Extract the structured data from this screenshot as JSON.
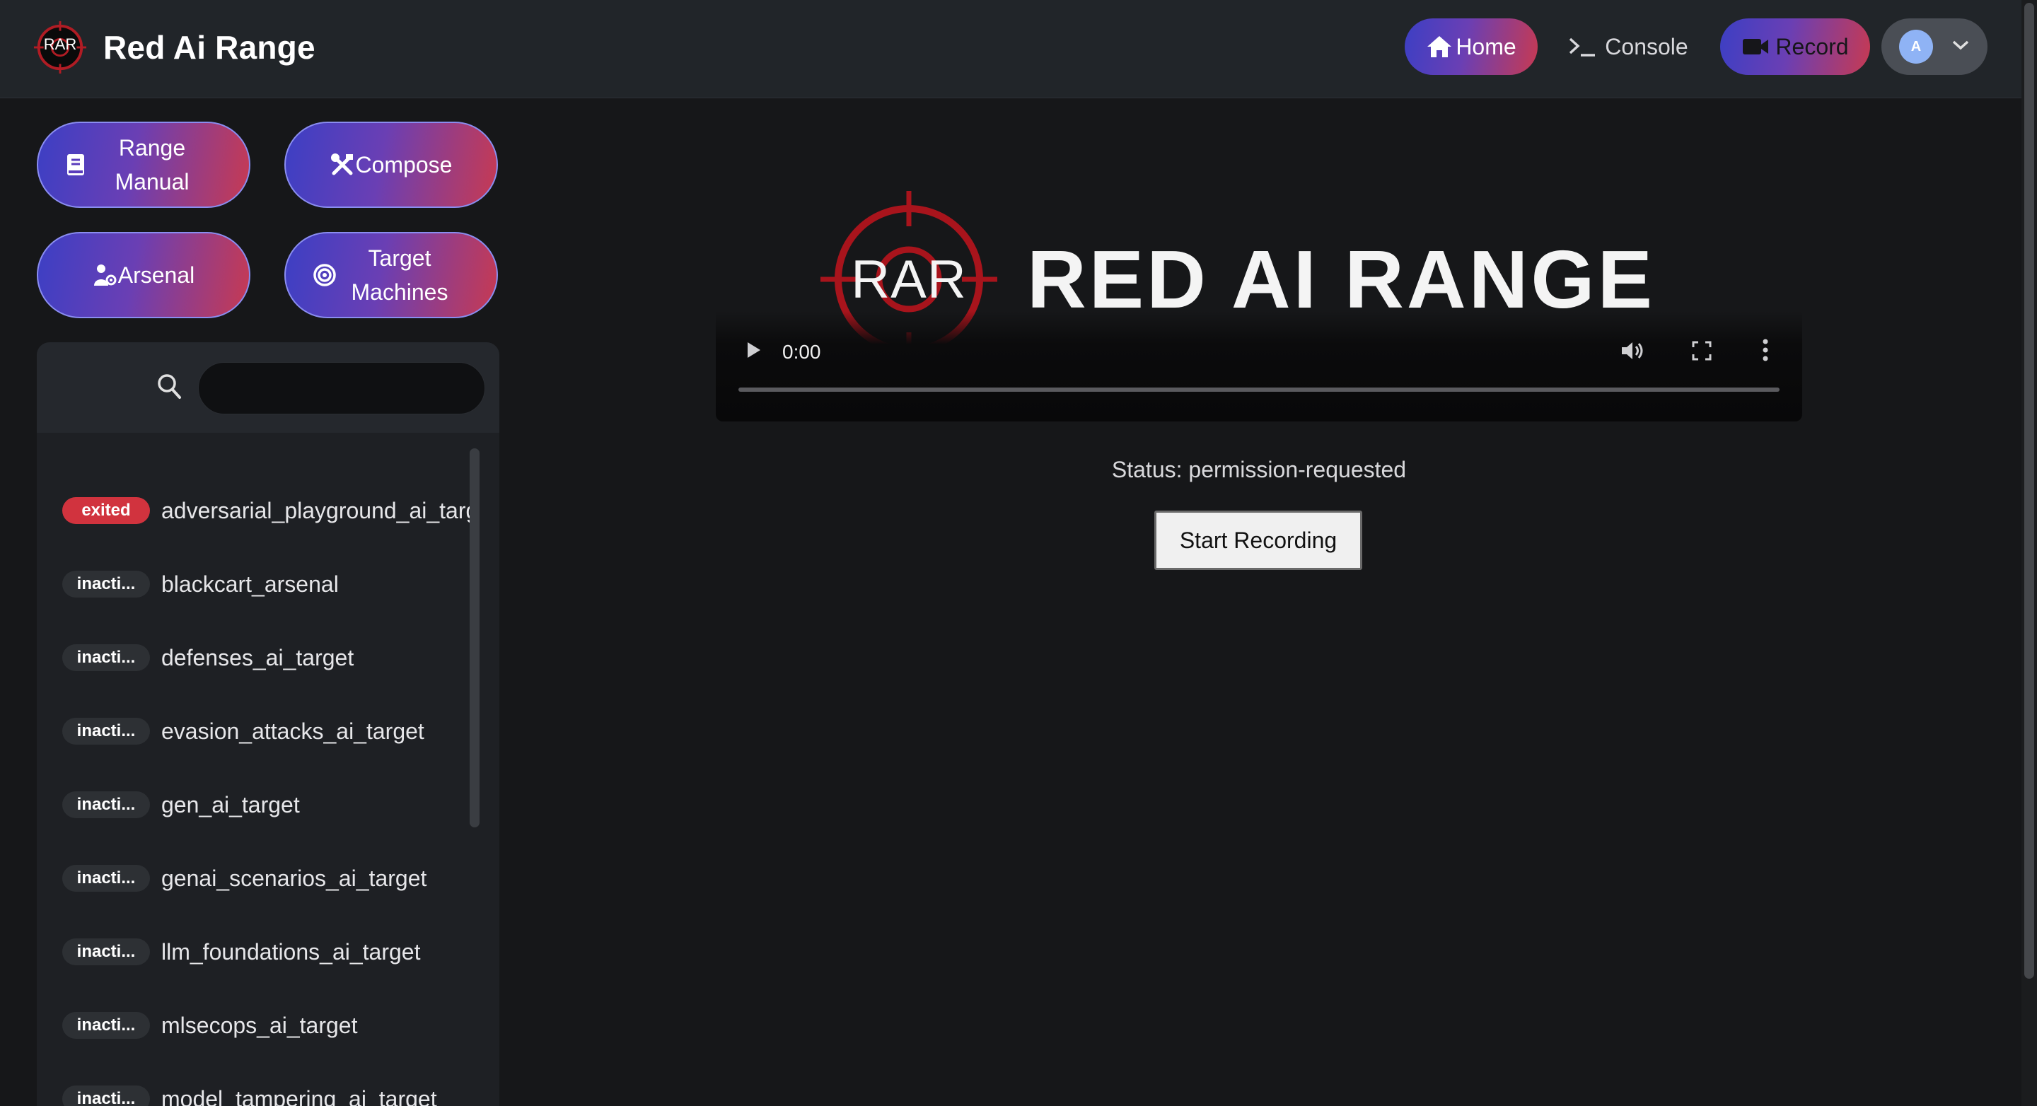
{
  "header": {
    "brand_logo_text": "RAR",
    "title": "Red Ai Range",
    "nav": {
      "home": "Home",
      "console": "Console",
      "record": "Record"
    },
    "user_initial": "A"
  },
  "sidebar": {
    "buttons": {
      "manual": "Range Manual",
      "compose": "Compose",
      "arsenal": "Arsenal",
      "targets": "Target Machines"
    },
    "search": {
      "placeholder": "",
      "value": ""
    },
    "items": [
      {
        "badge": "exited",
        "name": "adversarial_playground_ai_target"
      },
      {
        "badge": "inacti...",
        "name": "blackcart_arsenal"
      },
      {
        "badge": "inacti...",
        "name": "defenses_ai_target"
      },
      {
        "badge": "inacti...",
        "name": "evasion_attacks_ai_target"
      },
      {
        "badge": "inacti...",
        "name": "gen_ai_target"
      },
      {
        "badge": "inacti...",
        "name": "genai_scenarios_ai_target"
      },
      {
        "badge": "inacti...",
        "name": "llm_foundations_ai_target"
      },
      {
        "badge": "inacti...",
        "name": "mlsecops_ai_target"
      },
      {
        "badge": "inacti...",
        "name": "model_tampering_ai_target"
      }
    ]
  },
  "main": {
    "banner_logo_text": "RAR",
    "banner_title": "RED AI RANGE",
    "video": {
      "time": "0:00",
      "progress": 0
    },
    "status": "Status: permission-requested",
    "start_button": "Start Recording"
  },
  "colors": {
    "accent_blue": "#3c3fc4",
    "accent_red": "#c73a52",
    "exited_badge": "#d1333e",
    "inactive_badge": "#2d3034",
    "background": "#161719"
  }
}
